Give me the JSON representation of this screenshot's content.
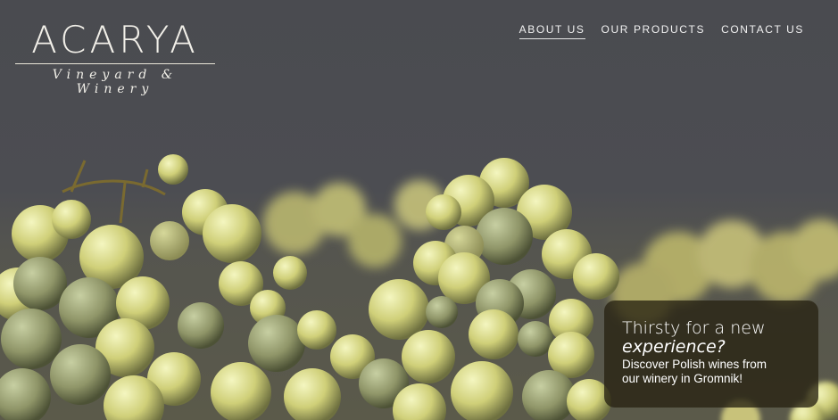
{
  "brand": {
    "name": "ACARYA",
    "tagline": "Vineyard & Winery"
  },
  "nav": {
    "items": [
      {
        "label": "ABOUT US",
        "active": true
      },
      {
        "label": "OUR PRODUCTS",
        "active": false
      },
      {
        "label": "CONTACT US",
        "active": false
      }
    ]
  },
  "promo": {
    "heading_line1": "Thirsty for a new",
    "heading_line2": "experience?",
    "body_line1": "Discover Polish wines from",
    "body_line2": "our winery in Gromnik!"
  },
  "colors": {
    "background": "#4a4b50",
    "grape": "#c9c77a",
    "grape_light": "#eef0a8",
    "card": "#2a2412"
  },
  "hero_image": "green-grape-clusters-photo"
}
